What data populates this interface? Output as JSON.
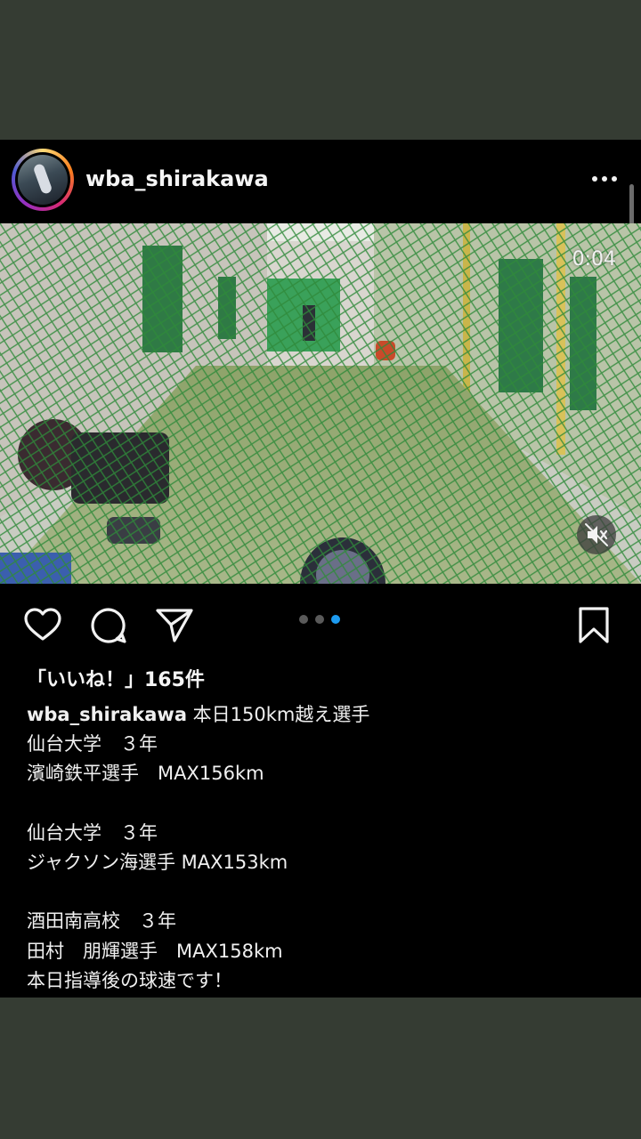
{
  "post": {
    "username": "wba_shirakawa",
    "video_time": "0:04",
    "carousel": {
      "count": 3,
      "active_index": 2,
      "active_color": "#1d9bf0"
    },
    "likes_text": "「いいね！」165件",
    "caption": {
      "first_text": " 本日150km越え選手",
      "lines": [
        "仙台大学　３年",
        "濱崎鉄平選手　MAX156km",
        "",
        "仙台大学　３年",
        "ジャクソン海選手 MAX153km",
        "",
        "酒田南高校　３年",
        "田村　朋輝選手　MAX158km",
        "本日指導後の球速です！"
      ]
    },
    "icons": {
      "header": "more-options-icon",
      "actions": [
        "heart-icon",
        "comment-icon",
        "share-icon",
        "bookmark-icon"
      ],
      "media": "muted-speaker-icon"
    }
  },
  "colors": {
    "background": "#353c33",
    "post_bg": "#000000"
  }
}
